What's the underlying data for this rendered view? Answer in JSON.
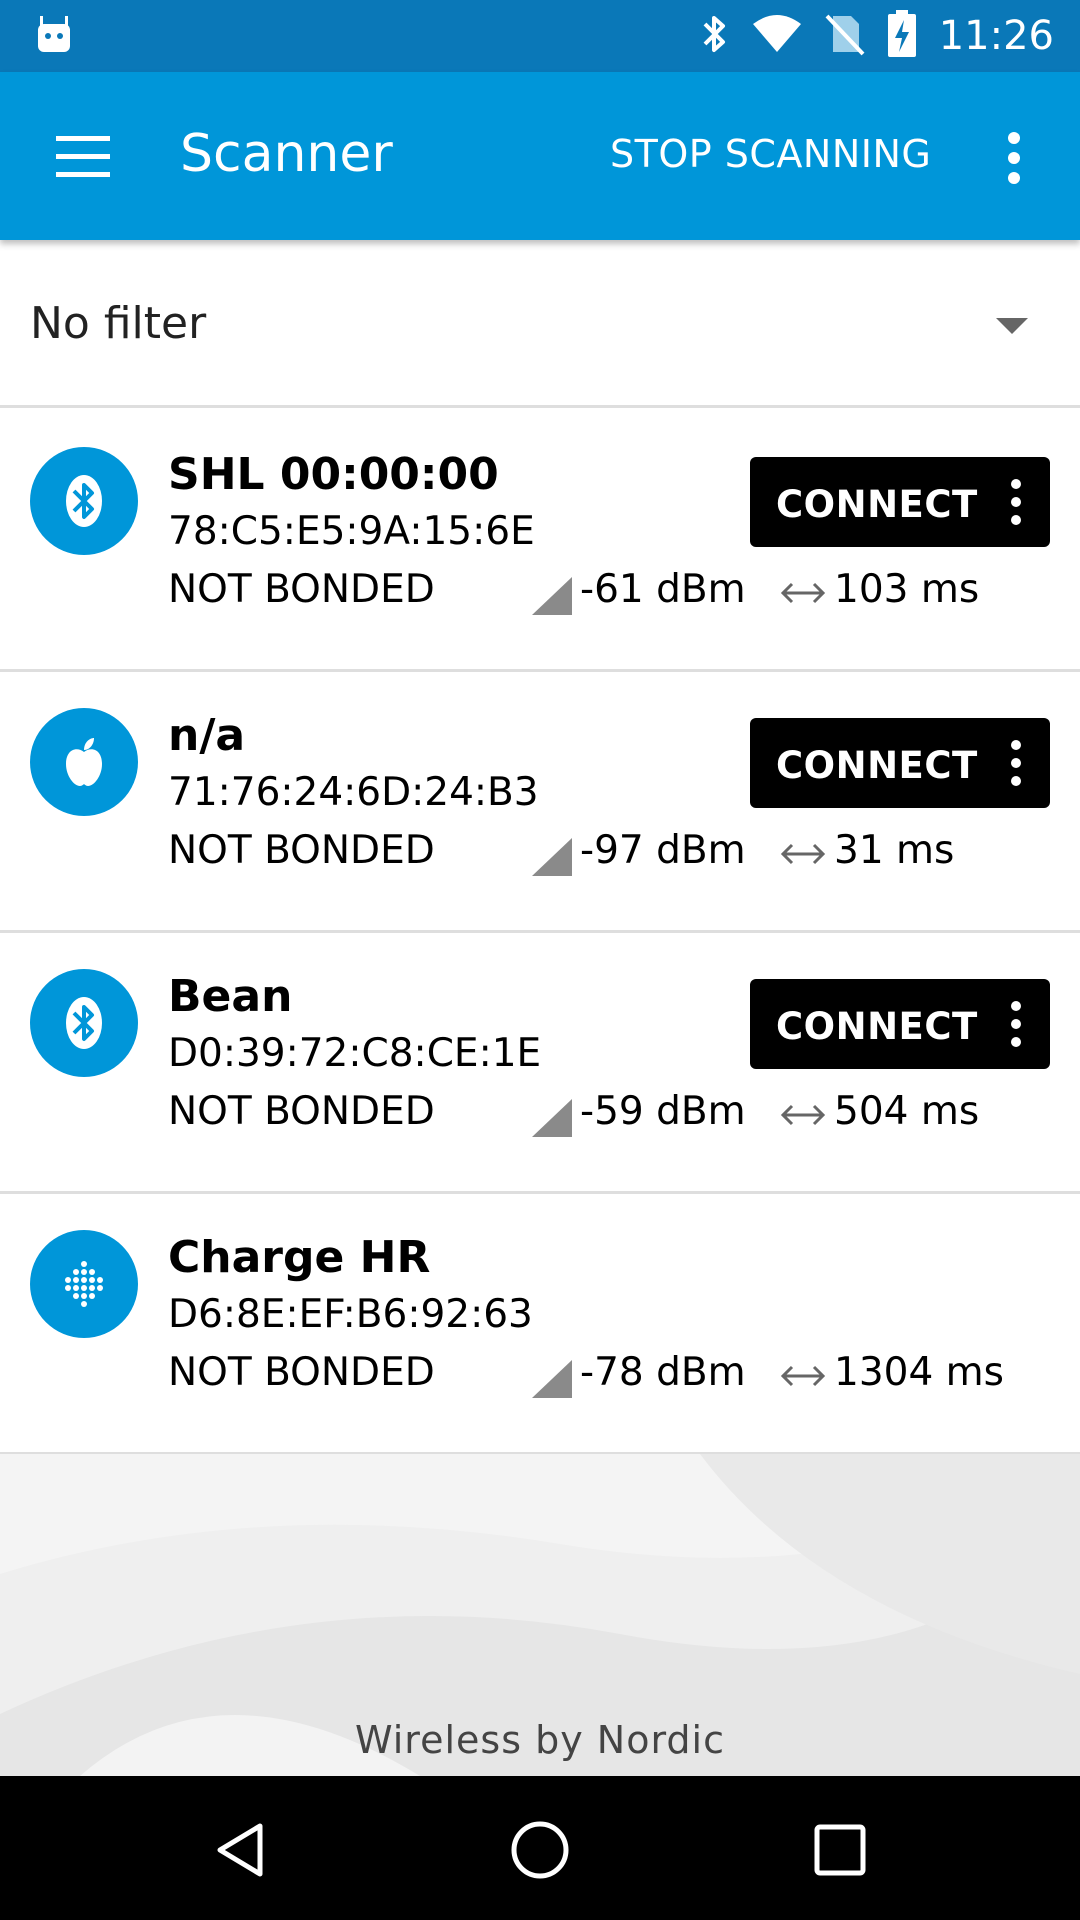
{
  "status_bar": {
    "time": "11:26",
    "icons": [
      "android-icon",
      "bluetooth-icon",
      "wifi-icon",
      "no-sim-icon",
      "battery-charging-icon"
    ]
  },
  "app_bar": {
    "title": "Scanner",
    "action_label": "STOP SCANNING",
    "menu_icon": "hamburger-menu-icon",
    "overflow_icon": "more-vert-icon",
    "color": "#0096d9"
  },
  "filter": {
    "label": "No filter",
    "icon": "dropdown-arrow-icon"
  },
  "devices": [
    {
      "name": "SHL 00:00:00",
      "address": "78:C5:E5:9A:15:6E",
      "bond_state": "NOT BONDED",
      "rssi": "-61 dBm",
      "interval": "103 ms",
      "icon": "bluetooth-icon",
      "connect_label": "CONNECT",
      "has_connect": true
    },
    {
      "name": "n/a",
      "address": "71:76:24:6D:24:B3",
      "bond_state": "NOT BONDED",
      "rssi": "-97 dBm",
      "interval": "31 ms",
      "icon": "apple-icon",
      "connect_label": "CONNECT",
      "has_connect": true
    },
    {
      "name": "Bean",
      "address": "D0:39:72:C8:CE:1E",
      "bond_state": "NOT BONDED",
      "rssi": "-59 dBm",
      "interval": "504 ms",
      "icon": "bluetooth-icon",
      "connect_label": "CONNECT",
      "has_connect": true
    },
    {
      "name": "Charge HR",
      "address": "D6:8E:EF:B6:92:63",
      "bond_state": "NOT BONDED",
      "rssi": "-78 dBm",
      "interval": "1304 ms",
      "icon": "fitbit-icon",
      "has_connect": false
    }
  ],
  "footer": {
    "brand": "Wireless by Nordic"
  },
  "nav_bar": {
    "buttons": [
      "back-icon",
      "home-icon",
      "recents-icon"
    ]
  },
  "colors": {
    "status_bar": "#0a78b8",
    "accent": "#0096d9",
    "button": "#000000"
  }
}
